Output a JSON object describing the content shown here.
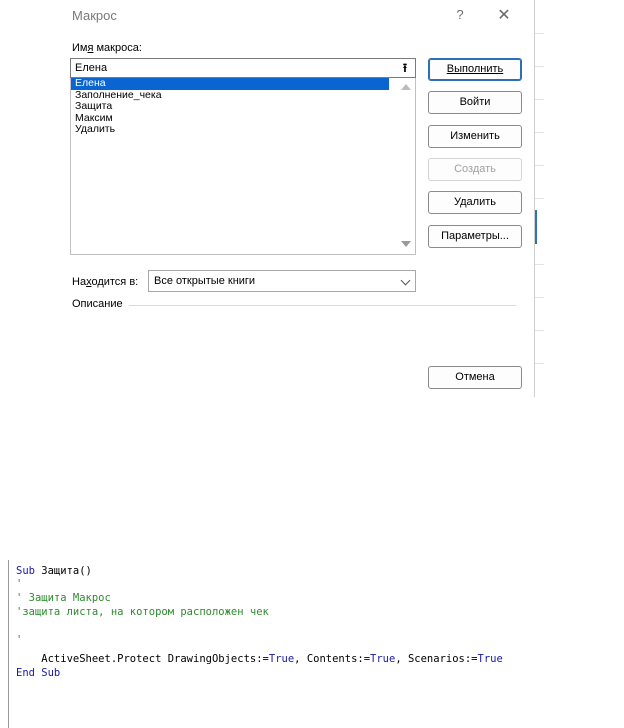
{
  "dialog": {
    "title": "Макрос",
    "help_icon": "?",
    "close_icon": "✕",
    "macro_name_label": "Имя макроса:",
    "macro_name_value": "Елена",
    "upload_icon": "⭱",
    "macros": [
      "Елена",
      "Заполнение_чека",
      "Защита",
      "Максим",
      "Удалить"
    ],
    "selected_macro": "Елена",
    "buttons": {
      "run": "Выполнить",
      "step_into": "Войти",
      "edit": "Изменить",
      "create": "Создать",
      "delete": "Удалить",
      "options": "Параметры...",
      "cancel": "Отмена"
    },
    "location_label": "Находится в:",
    "location_value": "Все открытые книги",
    "description_label": "Описание"
  },
  "code": {
    "line1_kw": "Sub",
    "line1_rest": " Защита()",
    "line2": "'",
    "line3": "' Защита Макрос",
    "line4": "'защита листа, на котором расположен чек",
    "line5": "",
    "line6": "'",
    "line7_a": "    ActiveSheet.Protect DrawingObjects:=",
    "line7_b": "True",
    "line7_c": ", Contents:=",
    "line7_d": "True",
    "line7_e": ", Scenarios:=",
    "line7_f": "True",
    "line8": "End Sub"
  }
}
